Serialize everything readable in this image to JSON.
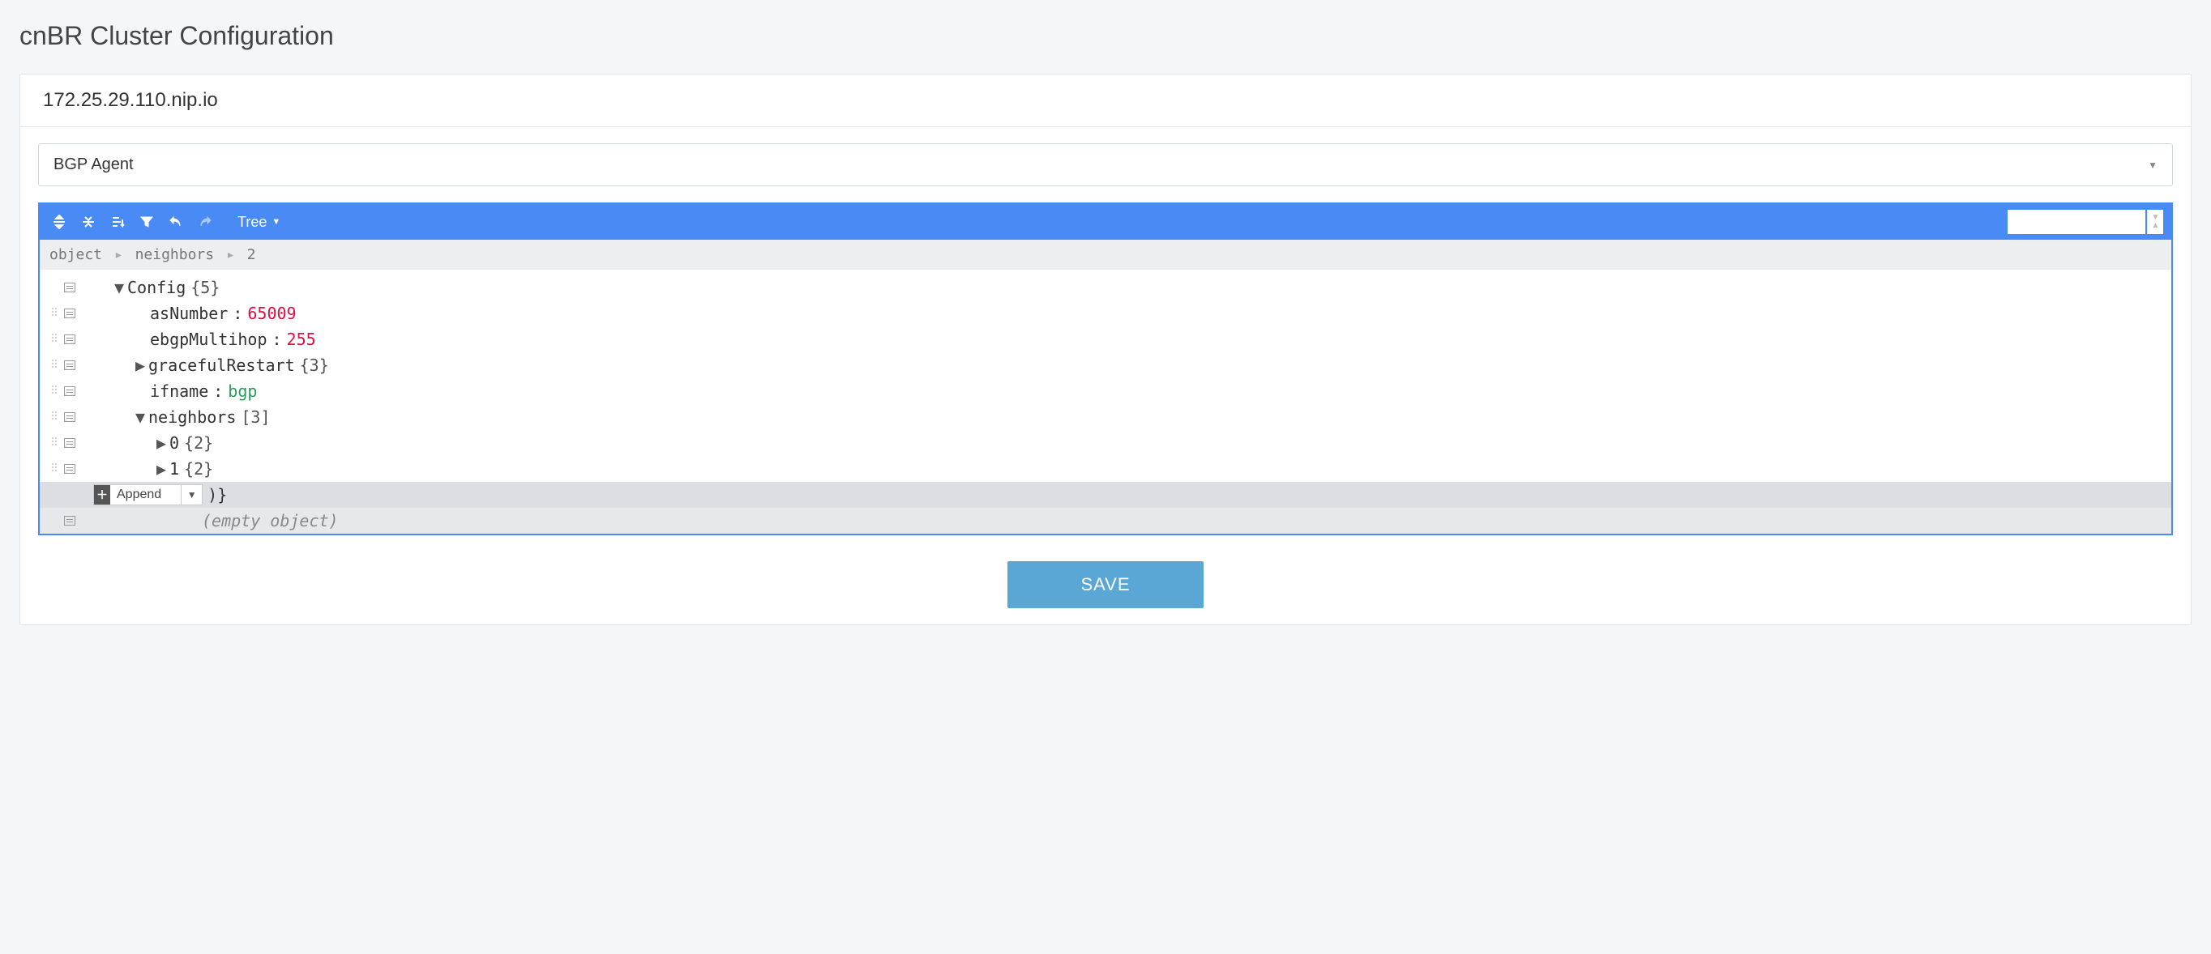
{
  "page_title": "cnBR Cluster Configuration",
  "host": "172.25.29.110.nip.io",
  "select_value": "BGP Agent",
  "toolbar": {
    "mode_label": "Tree",
    "search_placeholder": ""
  },
  "breadcrumb": [
    "object",
    "neighbors",
    "2"
  ],
  "tree": {
    "root": {
      "key": "Config",
      "count": "{5}"
    },
    "items": [
      {
        "key": "asNumber",
        "value": "65009",
        "vclass": "tval-num"
      },
      {
        "key": "ebgpMultihop",
        "value": "255",
        "vclass": "tval-num"
      },
      {
        "key": "gracefulRestart",
        "count": "{3}",
        "collapsed": true
      },
      {
        "key": "ifname",
        "value": "bgp",
        "vclass": "tval-kw"
      },
      {
        "key": "neighbors",
        "count": "[3]",
        "expanded": true,
        "children": [
          {
            "key": "0",
            "count": "{2}"
          },
          {
            "key": "1",
            "count": "{2}"
          }
        ]
      }
    ],
    "selected_tail": ")}",
    "empty_label": "(empty object)"
  },
  "append_label": "Append",
  "save_label": "SAVE"
}
